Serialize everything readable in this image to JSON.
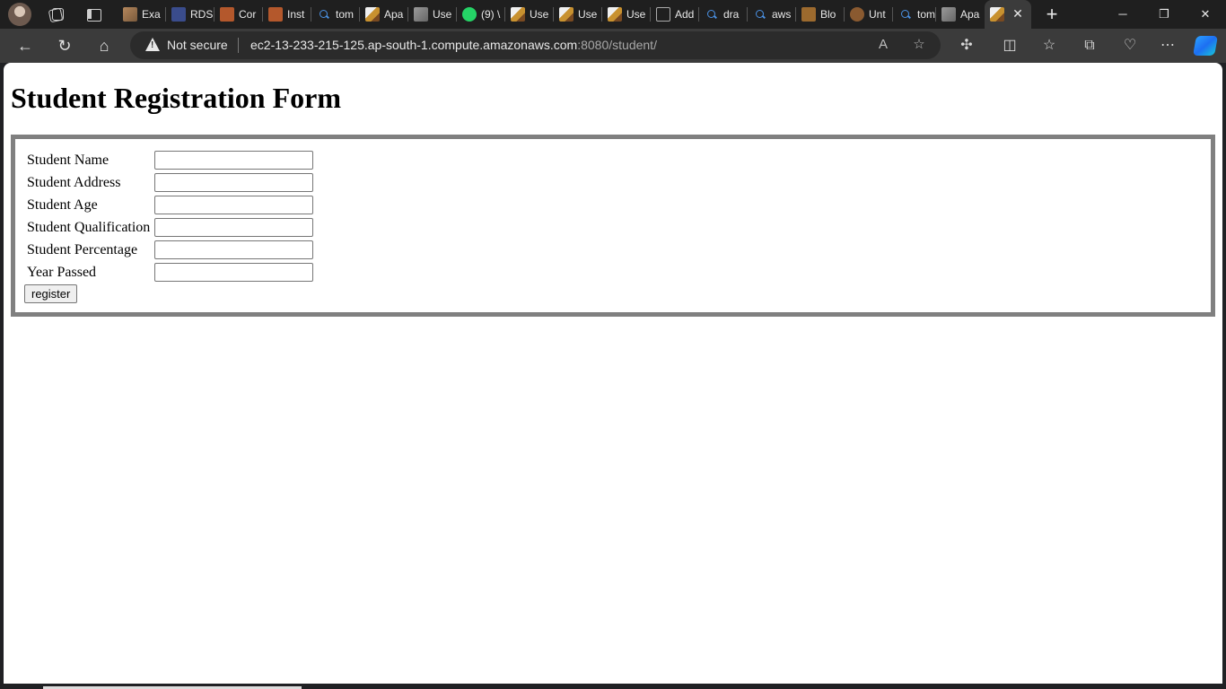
{
  "browser": {
    "tabs": [
      {
        "label": "Exa",
        "icon": "box"
      },
      {
        "label": "RDS",
        "icon": "rds"
      },
      {
        "label": "Cor",
        "icon": "orange"
      },
      {
        "label": "Inst",
        "icon": "orange"
      },
      {
        "label": "tom",
        "icon": "search"
      },
      {
        "label": "Apa",
        "icon": "cat"
      },
      {
        "label": "Use",
        "icon": "img"
      },
      {
        "label": "(9) \\",
        "icon": "wa"
      },
      {
        "label": "Use",
        "icon": "cat"
      },
      {
        "label": "Use",
        "icon": "cat"
      },
      {
        "label": "Use",
        "icon": "cat"
      },
      {
        "label": "Add",
        "icon": "cube"
      },
      {
        "label": "dra",
        "icon": "search"
      },
      {
        "label": "aws",
        "icon": "search"
      },
      {
        "label": "Blo",
        "icon": "blog"
      },
      {
        "label": "Unt",
        "icon": "ubuntu"
      },
      {
        "label": "tom",
        "icon": "search"
      },
      {
        "label": "Apa",
        "icon": "img"
      },
      {
        "label": "",
        "icon": "cat",
        "active": true
      }
    ],
    "security_label": "Not secure",
    "url_host": "ec2-13-233-215-125.ap-south-1.compute.amazonaws.com",
    "url_path": ":8080/student/"
  },
  "page": {
    "title": "Student Registration Form",
    "fields": [
      {
        "label": "Student Name",
        "value": ""
      },
      {
        "label": "Student Address",
        "value": ""
      },
      {
        "label": "Student Age",
        "value": ""
      },
      {
        "label": "Student Qualification",
        "value": ""
      },
      {
        "label": "Student Percentage",
        "value": ""
      },
      {
        "label": "Year Passed",
        "value": ""
      }
    ],
    "submit_label": "register"
  }
}
